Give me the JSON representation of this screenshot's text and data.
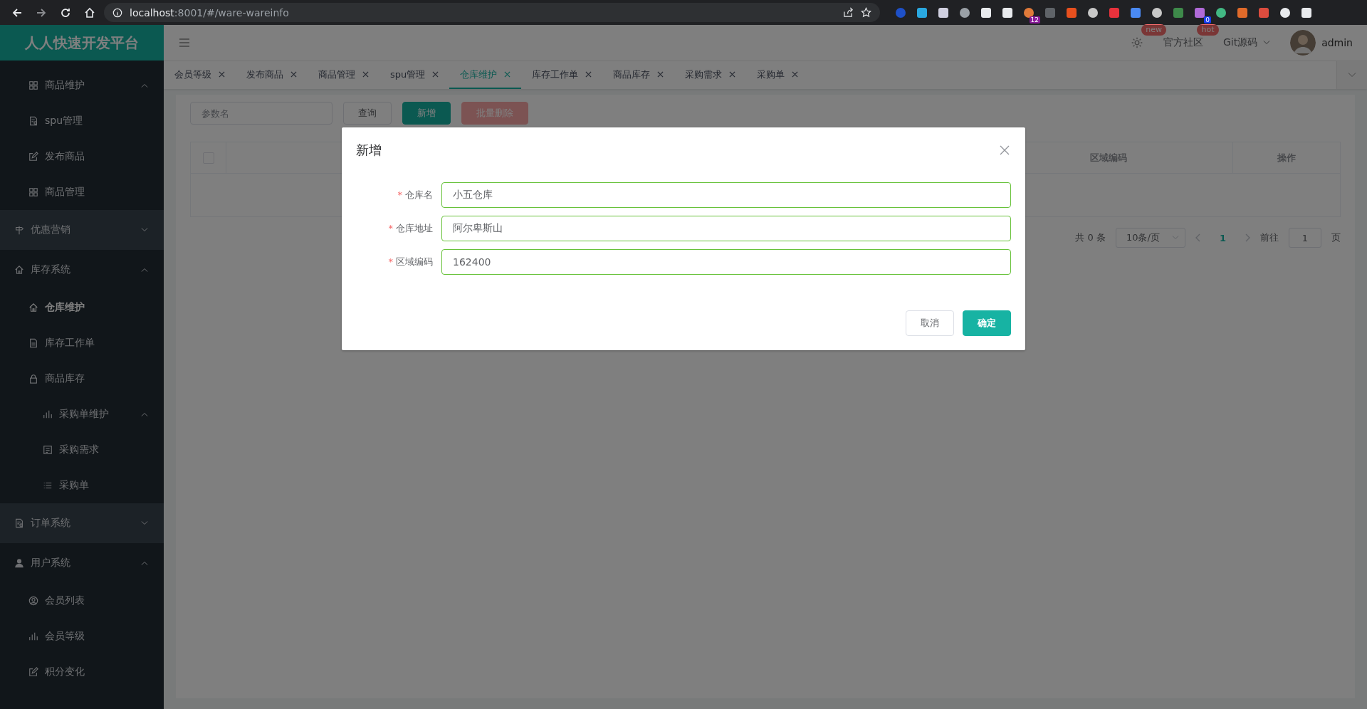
{
  "browser": {
    "host": "localhost",
    "path": ":8001/#/ware-wareinfo",
    "badges": [
      "12",
      "0"
    ]
  },
  "sidebar": {
    "logo": "人人快速开发平台",
    "items": [
      {
        "kind": "submenu",
        "label": "商品维护",
        "expanded": true,
        "children": [
          {
            "label": "spu管理",
            "selected": false
          },
          {
            "label": "发布商品",
            "selected": false
          },
          {
            "label": "商品管理",
            "selected": false
          }
        ]
      },
      {
        "kind": "menu",
        "label": "优惠营销",
        "expanded": false
      },
      {
        "kind": "menu",
        "label": "库存系统",
        "expanded": true,
        "children": [
          {
            "label": "仓库维护",
            "selected": true
          },
          {
            "label": "库存工作单",
            "selected": false
          },
          {
            "label": "商品库存",
            "selected": false
          },
          {
            "kind": "submenu",
            "label": "采购单维护",
            "expanded": true,
            "children": [
              {
                "label": "采购需求",
                "selected": false
              },
              {
                "label": "采购单",
                "selected": false
              }
            ]
          }
        ]
      },
      {
        "kind": "menu",
        "label": "订单系统",
        "expanded": false
      },
      {
        "kind": "menu",
        "label": "用户系统",
        "expanded": true,
        "children": [
          {
            "label": "会员列表",
            "selected": false
          },
          {
            "label": "会员等级",
            "selected": false
          },
          {
            "label": "积分变化",
            "selected": false
          }
        ]
      }
    ]
  },
  "header": {
    "settings_badge": "new",
    "community": "官方社区",
    "community_badge": "hot",
    "git": "Git源码",
    "user": "admin"
  },
  "tabs": [
    {
      "label": "会员等级",
      "selected": false
    },
    {
      "label": "发布商品",
      "selected": false
    },
    {
      "label": "商品管理",
      "selected": false
    },
    {
      "label": "spu管理",
      "selected": false
    },
    {
      "label": "仓库维护",
      "selected": true
    },
    {
      "label": "库存工作单",
      "selected": false
    },
    {
      "label": "商品库存",
      "selected": false
    },
    {
      "label": "采购需求",
      "selected": false
    },
    {
      "label": "采购单",
      "selected": false
    }
  ],
  "toolbar": {
    "search_placeholder": "参数名",
    "buttons": [
      {
        "label": "查询",
        "kind": "default"
      },
      {
        "label": "新增",
        "kind": "primary"
      },
      {
        "label": "批量删除",
        "kind": "danger"
      }
    ]
  },
  "table": {
    "select_all_checked": false,
    "columns": [
      "区域编码",
      "操作"
    ]
  },
  "pagination": {
    "total": "共 0 条",
    "page_size": "10条/页",
    "current": "1",
    "goto": "前往",
    "goto_value": "1",
    "page_unit": "页"
  },
  "dialog": {
    "title": "新增",
    "required_mark": "*",
    "fields": [
      {
        "label": "仓库名",
        "required": true,
        "value": "小五仓库"
      },
      {
        "label": "仓库地址",
        "required": true,
        "value": "阿尔卑斯山"
      },
      {
        "label": "区域编码",
        "required": true,
        "value": "162400"
      }
    ],
    "buttons": [
      {
        "label": "取消",
        "kind": "default"
      },
      {
        "label": "确定",
        "kind": "primary"
      }
    ]
  }
}
